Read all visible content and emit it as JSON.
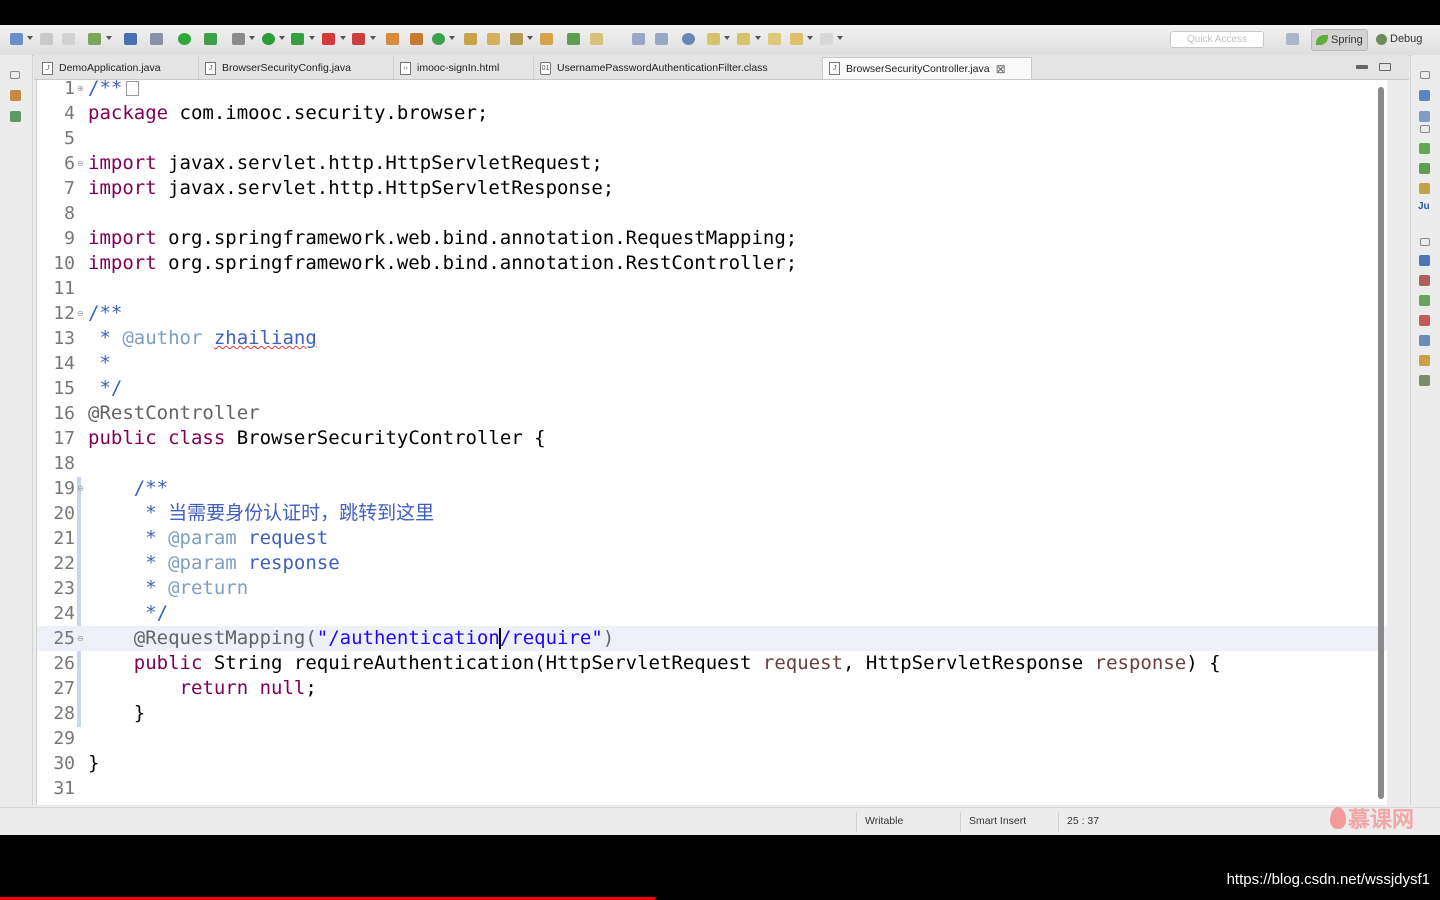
{
  "toolbar": {
    "quick_access_placeholder": "Quick Access",
    "perspectives": [
      {
        "label": "Spring",
        "active": true
      },
      {
        "label": "Debug",
        "active": false
      }
    ]
  },
  "tabs": [
    {
      "label": "DemoApplication.java",
      "icon": "java-file-icon",
      "active": false
    },
    {
      "label": "BrowserSecurityConfig.java",
      "icon": "java-file-icon",
      "active": false
    },
    {
      "label": "imooc-signIn.html",
      "icon": "html-file-icon",
      "active": false
    },
    {
      "label": "UsernamePasswordAuthenticationFilter.class",
      "icon": "class-file-icon",
      "active": false
    },
    {
      "label": "BrowserSecurityController.java",
      "icon": "java-file-icon",
      "active": true
    }
  ],
  "editor": {
    "line_numbers": [
      "1",
      "4",
      "5",
      "6",
      "7",
      "8",
      "9",
      "10",
      "11",
      "12",
      "13",
      "14",
      "15",
      "16",
      "17",
      "18",
      "19",
      "20",
      "21",
      "22",
      "23",
      "24",
      "25",
      "26",
      "27",
      "28",
      "29",
      "30",
      "31"
    ],
    "code": {
      "l1": "/**",
      "l4_kw": "package",
      "l4_rest": " com.imooc.security.browser;",
      "l6_kw": "import",
      "l6_rest": " javax.servlet.http.HttpServletRequest;",
      "l7_kw": "import",
      "l7_rest": " javax.servlet.http.HttpServletResponse;",
      "l9_kw": "import",
      "l9_rest": " org.springframework.web.bind.annotation.RequestMapping;",
      "l10_kw": "import",
      "l10_rest": " org.springframework.web.bind.annotation.RestController;",
      "l12": "/**",
      "l13_star": " * ",
      "l13_tag": "@author",
      "l13_sp": " ",
      "l13_name": "zhailiang",
      "l14": " *",
      "l15": " */",
      "l16": "@RestController",
      "l17_kw1": "public",
      "l17_sp": " ",
      "l17_kw2": "class",
      "l17_rest": " BrowserSecurityController {",
      "l19": "    /**",
      "l20": "     * 当需要身份认证时，跳转到这里",
      "l21_star": "     * ",
      "l21_tag": "@param",
      "l21_rest": " request",
      "l22_star": "     * ",
      "l22_tag": "@param",
      "l22_rest": " response",
      "l23_star": "     * ",
      "l23_tag": "@return",
      "l24": "     */",
      "l25_ann": "    @RequestMapping(",
      "l25_str1": "\"/authentication",
      "l25_str2": "/require\"",
      "l25_close": ")",
      "l26_indent": "    ",
      "l26_kw": "public",
      "l26_a": " String requireAuthentication(HttpServletRequest ",
      "l26_p1": "request",
      "l26_b": ", HttpServletResponse ",
      "l26_p2": "response",
      "l26_c": ") {",
      "l27_indent": "        ",
      "l27_kw1": "return",
      "l27_sp": " ",
      "l27_kw2": "null",
      "l27_semi": ";",
      "l28": "    }",
      "l30": "}"
    }
  },
  "status": {
    "writable": "Writable",
    "insert_mode": "Smart Insert",
    "cursor_position": "25 : 37"
  },
  "watermark": {
    "logo_text": "慕课网",
    "url": "https://blog.csdn.net/wssjdysf1"
  },
  "video_progress": 0.455
}
